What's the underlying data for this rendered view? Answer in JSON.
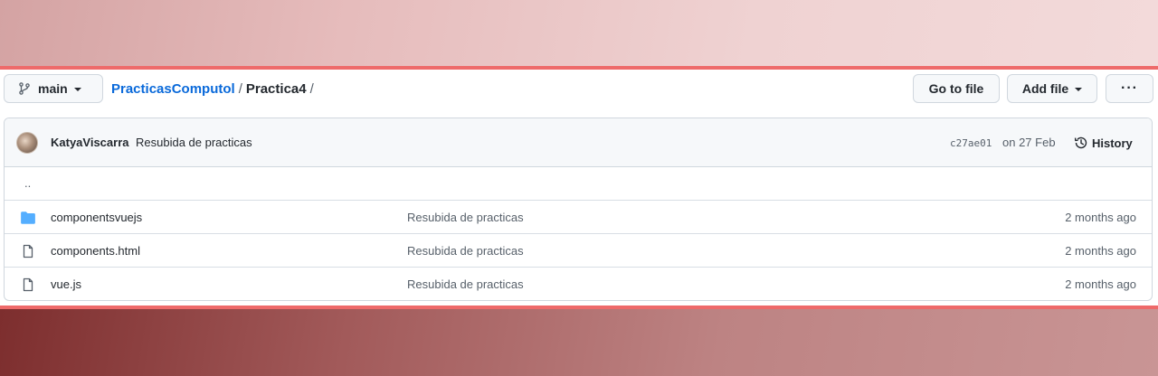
{
  "toolbar": {
    "branch_label": "main",
    "breadcrumb": {
      "repo": "PracticasComputol",
      "separator": "/",
      "current": "Practica4",
      "trailing": "/"
    },
    "go_to_file_label": "Go to file",
    "add_file_label": "Add file",
    "more_label": "···"
  },
  "commit": {
    "author": "KatyaViscarra",
    "message": "Resubida de practicas",
    "sha": "c27ae01",
    "date": "on 27 Feb",
    "history_label": "History"
  },
  "files": {
    "parent_label": "..",
    "items": [
      {
        "type": "folder",
        "icon": "folder-icon",
        "name": "componentsvuejs",
        "message": "Resubida de practicas",
        "age": "2 months ago"
      },
      {
        "type": "file",
        "icon": "file-icon",
        "name": "components.html",
        "message": "Resubida de practicas",
        "age": "2 months ago"
      },
      {
        "type": "file",
        "icon": "file-icon",
        "name": "vue.js",
        "message": "Resubida de practicas",
        "age": "2 months ago"
      }
    ]
  },
  "colors": {
    "accent_link": "#0969da",
    "folder": "#54aeff",
    "band_border": "#ee6a6a"
  }
}
